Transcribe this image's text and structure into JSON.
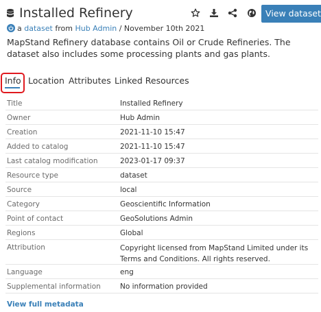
{
  "header": {
    "title": "Installed Refinery",
    "view_button_label": "View dataset",
    "icons": [
      "database-icon",
      "star-icon",
      "download-icon",
      "share-icon",
      "globe-icon"
    ]
  },
  "byline": {
    "prefix": "a",
    "type_link": "dataset",
    "from_text": "from",
    "owner_link": "Hub Admin",
    "date": "/ November 10th 2021"
  },
  "description": "MapStand Refinery database contains Oil or Crude Refineries. The dataset also includes some processing plants and gas plants.",
  "tabs": [
    {
      "label": "Info",
      "active": true
    },
    {
      "label": "Location",
      "active": false
    },
    {
      "label": "Attributes",
      "active": false
    },
    {
      "label": "Linked Resources",
      "active": false
    }
  ],
  "metadata": [
    {
      "key": "Title",
      "value": "Installed Refinery",
      "link": false
    },
    {
      "key": "Owner",
      "value": "Hub Admin",
      "link": true
    },
    {
      "key": "Creation",
      "value": "2021-11-10 15:47",
      "link": false
    },
    {
      "key": "Added to catalog",
      "value": "2021-11-10 15:47",
      "link": false
    },
    {
      "key": "Last catalog modification",
      "value": "2023-01-17 09:37",
      "link": false
    },
    {
      "key": "Resource type",
      "value": "dataset",
      "link": true
    },
    {
      "key": "Source",
      "value": "local",
      "link": false
    },
    {
      "key": "Category",
      "value": "Geoscientific Information",
      "link": true
    },
    {
      "key": "Point of contact",
      "value": "GeoSolutions Admin",
      "link": true
    },
    {
      "key": "Regions",
      "value": "Global",
      "link": true
    },
    {
      "key": "Attribution",
      "value": "Copyright licensed from MapStand Limited under its Terms and Conditions. All rights reserved.",
      "link": false
    },
    {
      "key": "Language",
      "value": "eng",
      "link": false
    },
    {
      "key": "Supplemental information",
      "value": "No information provided",
      "link": false
    }
  ],
  "footer": {
    "view_full_metadata": "View full metadata"
  },
  "colors": {
    "accent": "#3a80b8",
    "highlight": "#e0191e",
    "text": "#333333",
    "muted": "#6b6b6b"
  }
}
